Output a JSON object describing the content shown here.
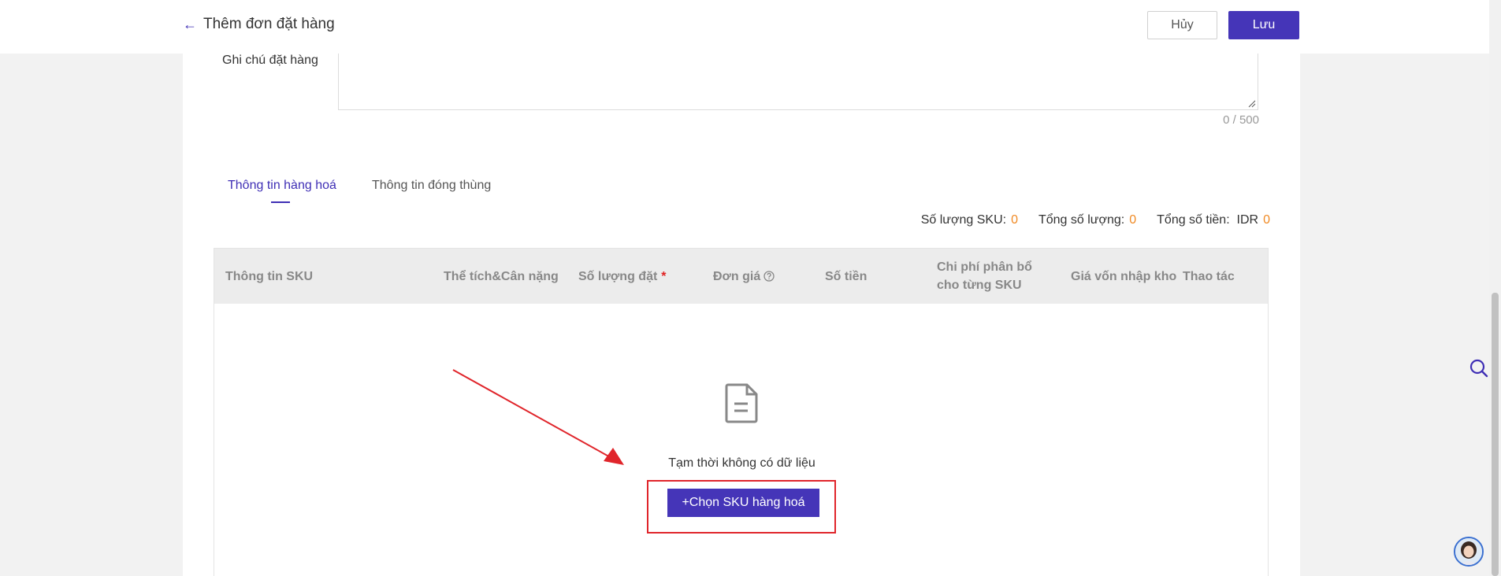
{
  "header": {
    "title": "Thêm đơn đặt hàng",
    "cancel_label": "Hủy",
    "save_label": "Lưu"
  },
  "note": {
    "label": "Ghi chú đặt hàng",
    "value": "",
    "counter": "0 / 500"
  },
  "tabs": [
    {
      "label": "Thông tin hàng hoá",
      "active": true
    },
    {
      "label": "Thông tin đóng thùng",
      "active": false
    }
  ],
  "summary": {
    "sku_count_label": "Số lượng SKU:",
    "sku_count": "0",
    "total_qty_label": "Tổng số lượng:",
    "total_qty": "0",
    "total_amount_label": "Tổng số tiền:",
    "currency": "IDR",
    "total_amount": "0"
  },
  "table": {
    "columns": [
      "Thông tin SKU",
      "Thể tích&Cân nặng",
      "Số lượng đặt",
      "Đơn giá",
      "Số tiền",
      "Chi phí phân bổ cho từng SKU",
      "Giá vốn nhập kho",
      "Thao tác"
    ],
    "required_mark": "*",
    "empty_text": "Tạm thời không có dữ liệu",
    "add_button_label": "+Chọn SKU hàng hoá"
  },
  "colors": {
    "accent": "#4535b8",
    "highlight": "#e0252b",
    "number": "#f08a24"
  },
  "icons": [
    "back-arrow-icon",
    "help-circle-icon",
    "empty-document-icon",
    "search-icon",
    "support-avatar"
  ]
}
